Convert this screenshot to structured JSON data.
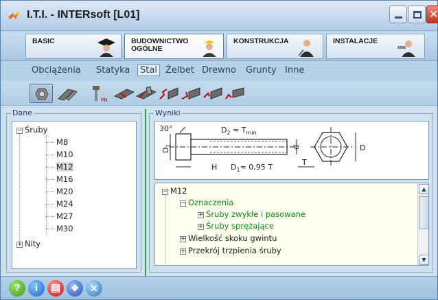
{
  "window": {
    "title": "I.T.I. - INTERsoft [L01]"
  },
  "modules": [
    {
      "l1": "BASIC",
      "l2": ""
    },
    {
      "l1": "BUDOWNICTWO",
      "l2": "OGÓLNE"
    },
    {
      "l1": "KONSTRUKCJA",
      "l2": ""
    },
    {
      "l1": "INSTALACJE",
      "l2": ""
    }
  ],
  "materials": [
    "Obciążenia",
    "Statyka",
    "Stal",
    "Żelbet",
    "Drewno",
    "Grunty",
    "Inne"
  ],
  "selected_material": "Stal",
  "left_panel": {
    "title": "Dane",
    "root": "Śruby",
    "items": [
      "M8",
      "M10",
      "M12",
      "M16",
      "M20",
      "M24",
      "M27",
      "M30"
    ],
    "selected": "M12",
    "other": "Nity"
  },
  "right_panel": {
    "title": "Wyniki",
    "drawing": {
      "angle": "30°",
      "d2": "D",
      "d2_sub": "2",
      "d2_rest": " ≈ T",
      "d2_min": "min",
      "d1": "D",
      "d1_sub": "1",
      "h": "H",
      "d1bottom": "D",
      "d1bottom_sub": "1",
      "d1bottom_rest": "≈ 0,95 T",
      "d": "d",
      "t": "T",
      "D": "D"
    },
    "tree": {
      "root": "M12",
      "oznaczenia": "Oznaczenia",
      "zwykle": "Śruby zwykłe i pasowane",
      "sprezajace": "Śruby sprężające",
      "skok": "Wielkość skoku gwintu",
      "przekroj": "Przekrój trzpienia śruby"
    }
  },
  "colors": {
    "accent": "#0a8a16",
    "toolbar_bg": "#b3d2e8"
  },
  "icons": [
    "help-icon",
    "info-icon",
    "print-icon",
    "navigate-icon",
    "tools-icon"
  ]
}
